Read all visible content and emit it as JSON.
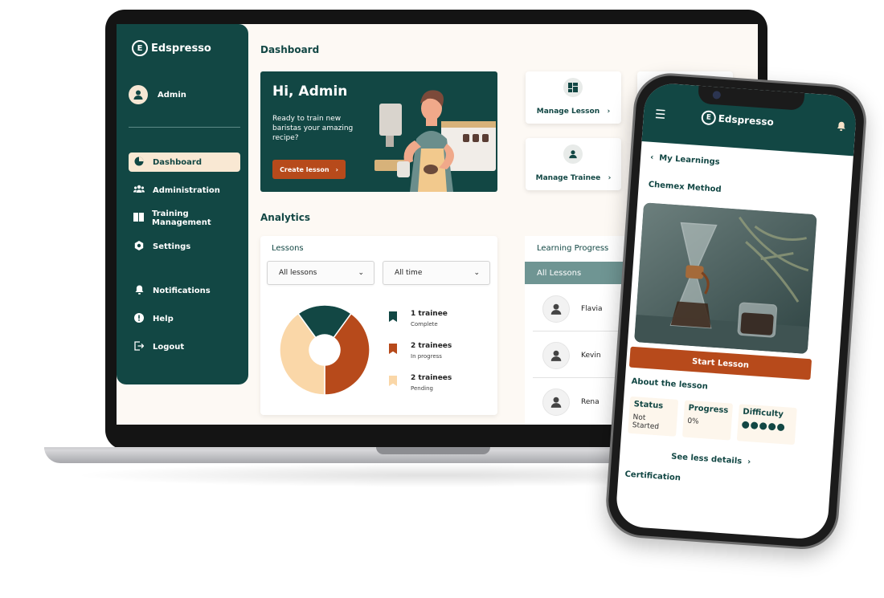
{
  "brand": "Edspresso",
  "colors": {
    "primary": "#124744",
    "accent": "#b74a1b",
    "cream": "#f9e8d3",
    "muted_teal": "#6f9593",
    "pending": "#fad7a8"
  },
  "sidebar": {
    "user": "Admin",
    "items": [
      {
        "label": "Dashboard",
        "icon": "pie-chart-icon"
      },
      {
        "label": "Administration",
        "icon": "people-icon"
      },
      {
        "label": "Training Management",
        "icon": "book-icon"
      },
      {
        "label": "Settings",
        "icon": "gear-icon"
      },
      {
        "label": "Notifications",
        "icon": "bell-icon"
      },
      {
        "label": "Help",
        "icon": "info-icon"
      },
      {
        "label": "Logout",
        "icon": "logout-icon"
      }
    ]
  },
  "dashboard": {
    "title": "Dashboard",
    "hero": {
      "greeting": "Hi, Admin",
      "subtitle": "Ready to train new baristas your amazing recipe?",
      "button": "Create lesson"
    },
    "actions": [
      {
        "label": "Manage Lesson",
        "icon": "layout-icon"
      },
      {
        "label": "Manage Trainee",
        "icon": "person-icon"
      }
    ],
    "analytics_title": "Analytics",
    "lessons": {
      "title": "Lessons",
      "filter_lessons": "All lessons",
      "filter_time": "All time"
    },
    "learning_progress": {
      "title": "Learning Progress",
      "tab": "All Lessons",
      "trainees": [
        "Flavia",
        "Kevin",
        "Rena"
      ]
    }
  },
  "chart_data": {
    "type": "pie",
    "title": "",
    "slices": [
      {
        "count": "1 trainee",
        "status": "Complete",
        "value": 1,
        "color": "#124744"
      },
      {
        "count": "2 trainees",
        "status": "In progress",
        "value": 2,
        "color": "#b74a1b"
      },
      {
        "count": "2 trainees",
        "status": "Pending",
        "value": 2,
        "color": "#fad7a8"
      }
    ]
  },
  "mobile": {
    "back": "My Learnings",
    "lesson": "Chemex Method",
    "start_button": "Start Lesson",
    "about": "About the lesson",
    "status_label": "Status",
    "status_value": "Not Started",
    "progress_label": "Progress",
    "progress_value": "0%",
    "difficulty_label": "Difficulty",
    "difficulty_level": 5,
    "see_less": "See less details",
    "certification": "Certification"
  }
}
